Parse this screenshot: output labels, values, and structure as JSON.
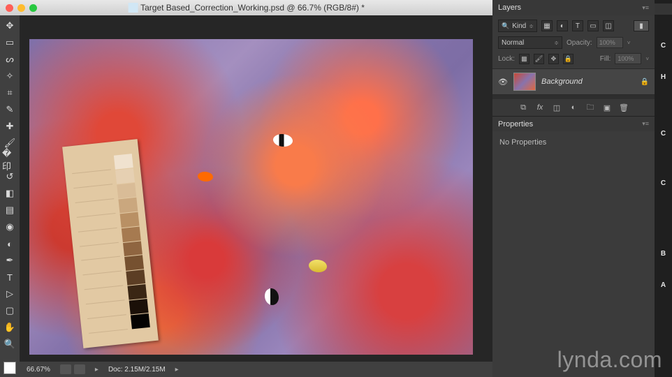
{
  "window": {
    "title": "Target Based_Correction_Working.psd @ 66.7% (RGB/8#) *"
  },
  "status": {
    "zoom": "66.67%",
    "doc_label": "Doc:",
    "doc_size": "2.15M/2.15M"
  },
  "layers_panel": {
    "title": "Layers",
    "filter_kind": "Kind",
    "blend_mode": "Normal",
    "opacity_label": "Opacity:",
    "opacity_value": "100%",
    "lock_label": "Lock:",
    "fill_label": "Fill:",
    "fill_value": "100%",
    "layers": [
      {
        "name": "Background",
        "locked": true,
        "visible": true
      }
    ]
  },
  "properties_panel": {
    "title": "Properties",
    "body": "No Properties"
  },
  "right_tabs": [
    "C",
    "H",
    "C",
    "C",
    "B",
    "A"
  ],
  "watermark": "lynda.com",
  "tools": [
    "move",
    "marquee",
    "lasso",
    "wand",
    "crop",
    "eyedropper",
    "spot-heal",
    "brush",
    "clone",
    "history-brush",
    "eraser",
    "gradient",
    "blur",
    "dodge",
    "pen",
    "type",
    "path-select",
    "rectangle",
    "hand",
    "zoom"
  ],
  "colors": {
    "ui_bg": "#404040",
    "canvas_bg": "#262626"
  }
}
